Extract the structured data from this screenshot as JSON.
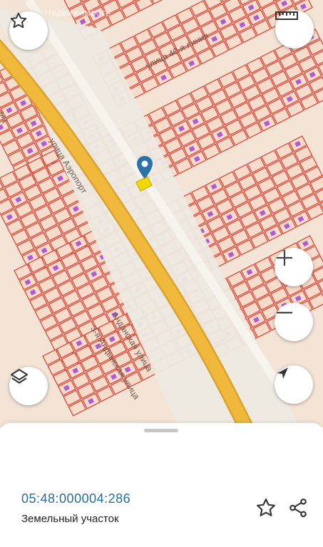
{
  "map": {
    "watermark": "Недвижимость",
    "streets": {
      "aeroport": "улица Аэропорт",
      "line40": "улица 40-я линия",
      "street_a": "Анданская улица",
      "street_b": "3-я Андынская улица",
      "partial_left": "ыц"
    },
    "colors": {
      "parcel_fill": "#f5dccb",
      "parcel_border": "#d9483b",
      "highway": "#f0b93c",
      "building": "#b05ad6",
      "pin": "#2b72a8",
      "selected_parcel": "#f4d700"
    }
  },
  "controls": {
    "favorite": "star-icon",
    "ruler": "ruler-icon",
    "zoom_in": "plus-icon",
    "zoom_out": "minus-icon",
    "layers": "layers-icon",
    "locate": "navigation-arrow-icon"
  },
  "sheet": {
    "cadastral_number": "05:48:000004:286",
    "object_type": "Земельный участок",
    "actions": [
      "star-icon",
      "share-icon"
    ]
  }
}
